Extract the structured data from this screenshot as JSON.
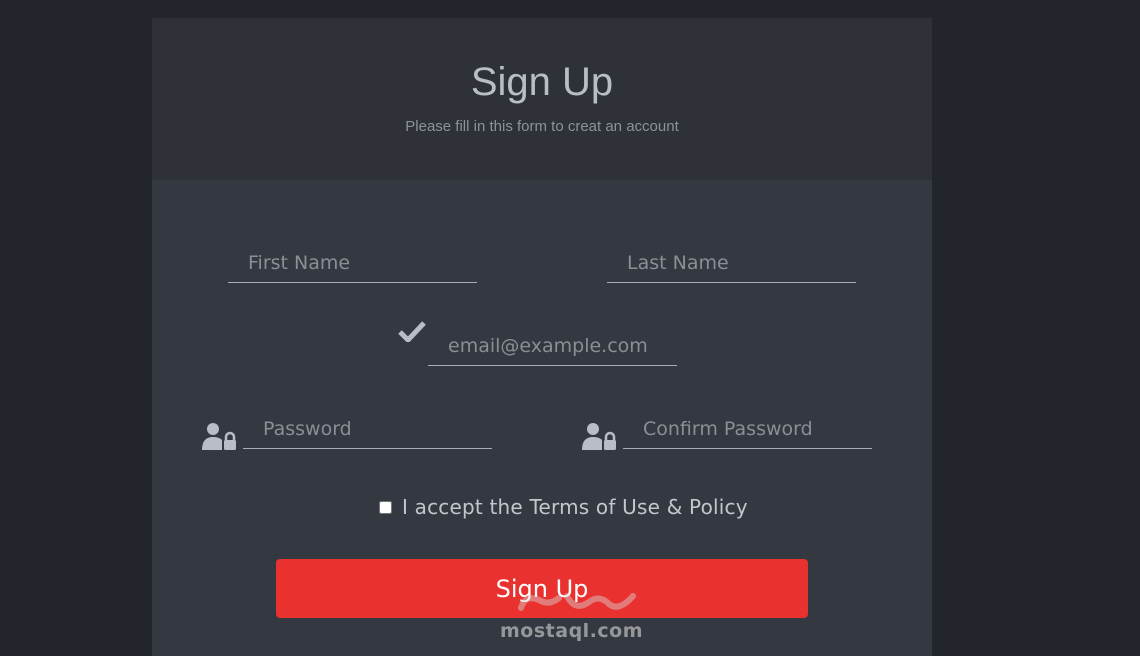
{
  "header": {
    "title": "Sign Up",
    "subtitle": "Please fill in this form to creat an account"
  },
  "form": {
    "first_name": {
      "placeholder": "First Name",
      "value": ""
    },
    "last_name": {
      "placeholder": "Last Name",
      "value": ""
    },
    "email": {
      "placeholder": "email@example.com",
      "value": "",
      "icon": "check-icon"
    },
    "password": {
      "placeholder": "Password",
      "value": "",
      "icon": "user-lock-icon"
    },
    "confirm_password": {
      "placeholder": "Confirm Password",
      "value": "",
      "icon": "user-lock-icon"
    },
    "terms": {
      "label": "I accept the Terms of Use & Policy",
      "checked": false
    },
    "submit_label": "Sign Up"
  },
  "watermark": {
    "text": "mostaql.com"
  },
  "colors": {
    "background": "#22252b",
    "card": "#343840",
    "card_header": "#2e3137",
    "accent": "#e93230"
  }
}
